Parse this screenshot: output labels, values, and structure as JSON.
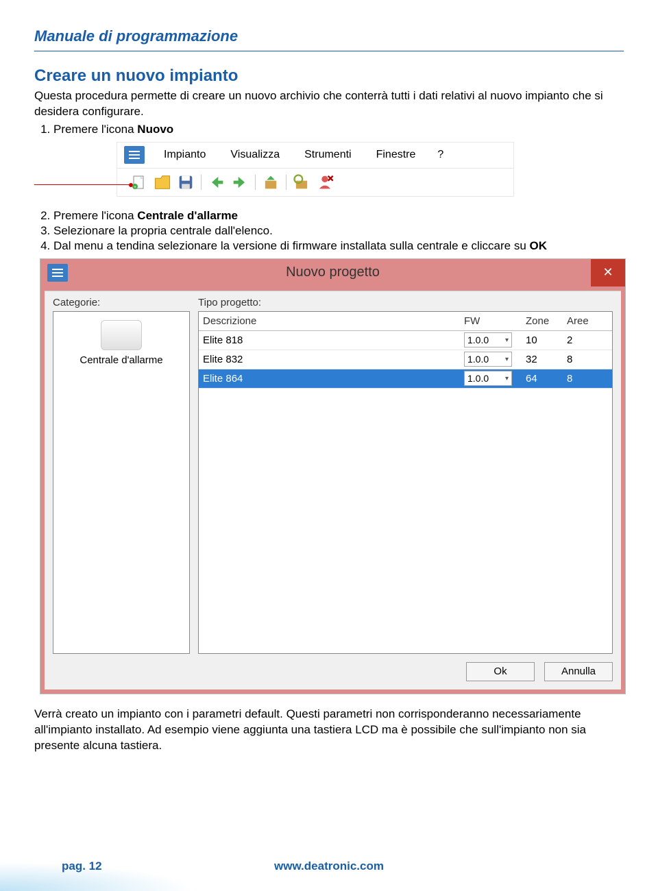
{
  "doc_title": "Manuale di programmazione",
  "section_title": "Creare un nuovo impianto",
  "intro_text": "Questa procedura permette di creare un nuovo archivio che conterrà tutti i dati relativi al nuovo impianto che si desidera configurare.",
  "step1_prefix": "Premere l'icona ",
  "step1_bold": "Nuovo",
  "step2_prefix": "Premere l'icona ",
  "step2_bold": "Centrale d'allarme",
  "step3": "Selezionare la propria centrale dall'elenco.",
  "step4_prefix": "Dal menu a tendina selezionare la versione di firmware installata sulla centrale e cliccare su ",
  "step4_bold": "OK",
  "toolbar": {
    "menus": [
      "Impianto",
      "Visualizza",
      "Strumenti",
      "Finestre"
    ],
    "help": "?"
  },
  "dialog": {
    "title": "Nuovo progetto",
    "categorie_label": "Categorie:",
    "tipo_label": "Tipo progetto:",
    "category_item": "Centrale d'allarme",
    "headers": {
      "desc": "Descrizione",
      "fw": "FW",
      "zone": "Zone",
      "aree": "Aree"
    },
    "rows": [
      {
        "desc": "Elite 818",
        "fw": "1.0.0",
        "zone": "10",
        "aree": "2",
        "selected": false
      },
      {
        "desc": "Elite 832",
        "fw": "1.0.0",
        "zone": "32",
        "aree": "8",
        "selected": false
      },
      {
        "desc": "Elite 864",
        "fw": "1.0.0",
        "zone": "64",
        "aree": "8",
        "selected": true
      }
    ],
    "ok": "Ok",
    "cancel": "Annulla"
  },
  "closing_text": "Verrà creato un impianto con i parametri default. Questi parametri non corrisponderanno necessariamente all'impianto installato. Ad esempio viene aggiunta una tastiera LCD ma è possibile che sull'impianto non sia presente alcuna tastiera.",
  "footer": {
    "page": "pag. 12",
    "url": "www.deatronic.com"
  }
}
